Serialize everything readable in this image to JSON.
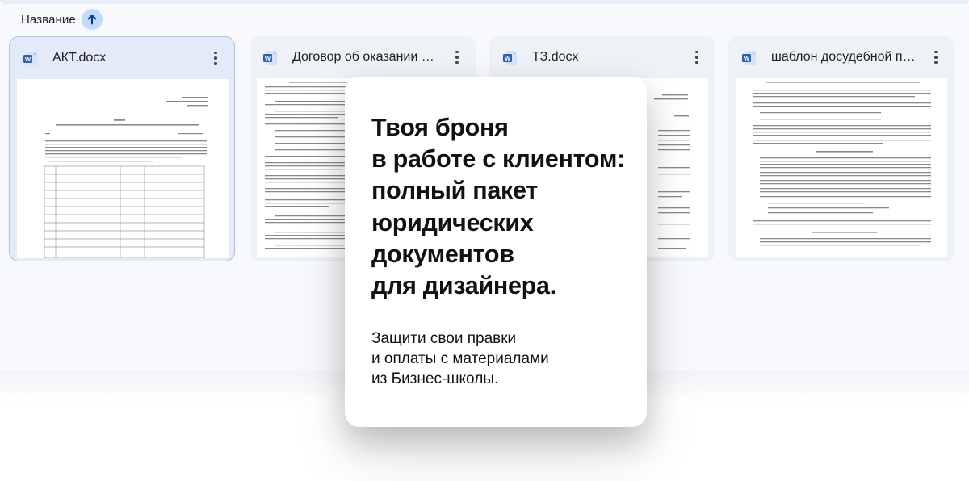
{
  "sort": {
    "label": "Название",
    "direction_icon": "arrow-up-icon"
  },
  "files": [
    {
      "name": "АКТ.docx",
      "icon": "word-doc-icon",
      "menu_icon": "more-vert-icon",
      "selected": true
    },
    {
      "name": "Договор об оказании услуг.docx",
      "icon": "word-doc-icon",
      "menu_icon": "more-vert-icon",
      "selected": false
    },
    {
      "name": "ТЗ.docx",
      "icon": "word-doc-icon",
      "menu_icon": "more-vert-icon",
      "selected": false
    },
    {
      "name": "шаблон досудебной претензии.docx",
      "icon": "word-doc-icon",
      "menu_icon": "more-vert-icon",
      "selected": false
    }
  ],
  "promo": {
    "title": "Твоя броня\nв работе с клиентом:\nполный пакет\nюридических\nдокументов\nдля дизайнера.",
    "subtitle": "Защити свои правки\nи оплаты с материалами\nиз Бизнес-школы."
  },
  "colors": {
    "accent": "#c2dbfb",
    "selected_border": "#a8c4ee",
    "word_blue": "#2b5fc4",
    "card_bg": "#eef1f6"
  }
}
